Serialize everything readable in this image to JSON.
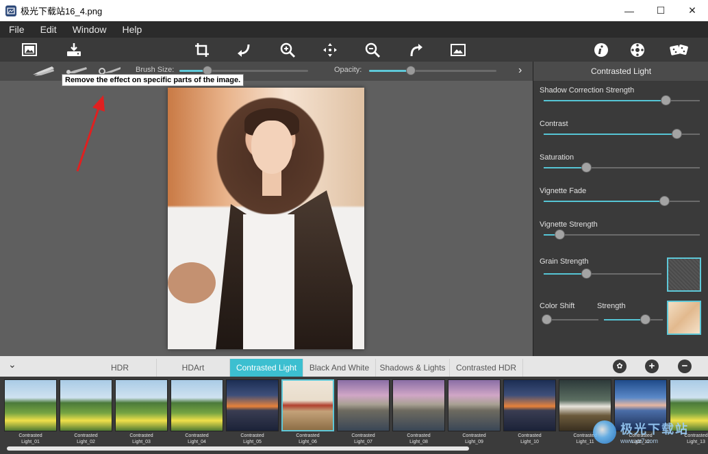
{
  "window": {
    "title": "极光下载站16_4.png",
    "controls": [
      "—",
      "☐",
      "✕"
    ]
  },
  "menu": [
    "File",
    "Edit",
    "Window",
    "Help"
  ],
  "subbar": {
    "brush_size_label": "Brush Size:",
    "brush_size_value": 0.22,
    "opacity_label": "Opacity:",
    "opacity_value": 0.33
  },
  "tooltip": "Remove the effect on specific parts of the image.",
  "right_panel": {
    "title": "Contrasted Light",
    "params": [
      {
        "label": "Shadow Correction Strength",
        "value": 0.78
      },
      {
        "label": "Contrast",
        "value": 0.85
      },
      {
        "label": "Saturation",
        "value": 0.27
      },
      {
        "label": "Vignette Fade",
        "value": 0.77
      },
      {
        "label": "Vignette Strength",
        "value": 0.1
      },
      {
        "label": "Grain Strength",
        "value": 0.36
      },
      {
        "label": "Color Shift",
        "value": 0.05
      },
      {
        "label": "Strength",
        "value": 0.7
      }
    ]
  },
  "categories": {
    "tabs": [
      "HDR",
      "HDArt",
      "Contrasted Light",
      "Black And White",
      "Shadows & Lights",
      "Contrasted HDR"
    ],
    "active": "Contrasted Light"
  },
  "presets": [
    {
      "line1": "Contrasted",
      "line2": "Light_01"
    },
    {
      "line1": "Contrasted",
      "line2": "Light_02"
    },
    {
      "line1": "Contrasted",
      "line2": "Light_03"
    },
    {
      "line1": "Contrasted",
      "line2": "Light_04"
    },
    {
      "line1": "Contrasted",
      "line2": "Light_05"
    },
    {
      "line1": "Contrasted",
      "line2": "Light_06"
    },
    {
      "line1": "Contrasted",
      "line2": "Light_07"
    },
    {
      "line1": "Contrasted",
      "line2": "Light_08"
    },
    {
      "line1": "Contrasted",
      "line2": "Light_09"
    },
    {
      "line1": "Contrasted",
      "line2": "Light_10"
    },
    {
      "line1": "Contrasted",
      "line2": "Light_11"
    },
    {
      "line1": "Contrasted",
      "line2": "Light_12"
    },
    {
      "line1": "Contrasted",
      "line2": "Light_13"
    }
  ],
  "selected_preset": "Light_06",
  "watermark": {
    "cn": "极光下载站",
    "url": "www.xz7.com"
  },
  "colors": {
    "accent": "#3cbfd0",
    "annotation": "#e02020"
  }
}
